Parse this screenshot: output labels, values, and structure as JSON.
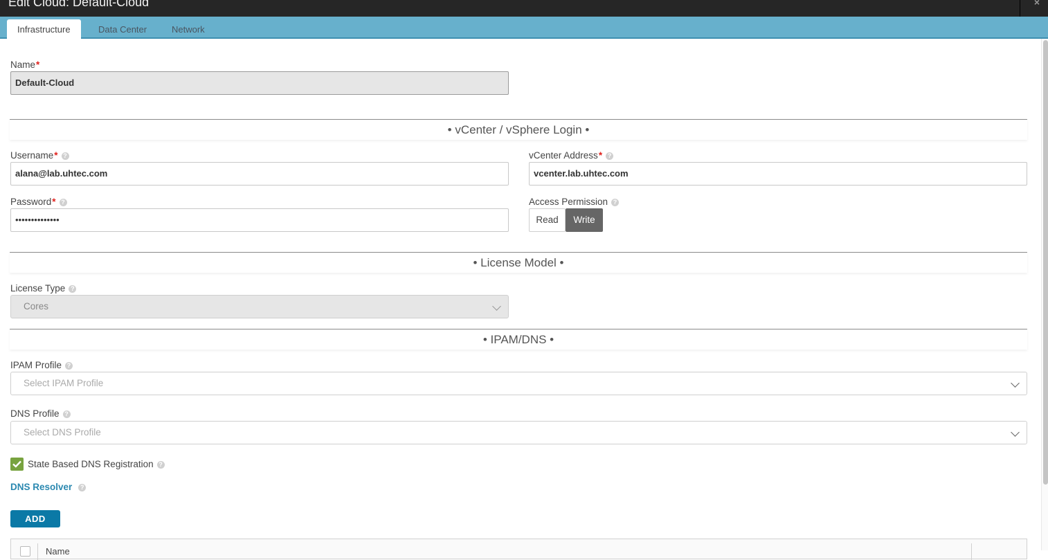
{
  "window": {
    "title": "Edit Cloud: Default-Cloud",
    "close_icon": "×"
  },
  "tabs": [
    {
      "label": "Infrastructure",
      "active": true
    },
    {
      "label": "Data Center",
      "active": false
    },
    {
      "label": "Network",
      "active": false
    }
  ],
  "form": {
    "name": {
      "label": "Name",
      "required_mark": "*",
      "value": "Default-Cloud"
    },
    "sections": {
      "vcenter": "• vCenter / vSphere Login •",
      "license": "• License Model •",
      "ipam_dns": "• IPAM/DNS •"
    },
    "username": {
      "label": "Username",
      "required_mark": "*",
      "value": "alana@lab.uhtec.com"
    },
    "password": {
      "label": "Password",
      "required_mark": "*",
      "value": "••••••••••••••"
    },
    "vcenter_address": {
      "label": "vCenter Address",
      "required_mark": "*",
      "value": "vcenter.lab.uhtec.com"
    },
    "access_permission": {
      "label": "Access Permission",
      "options": [
        "Read",
        "Write"
      ],
      "selected": "Write"
    },
    "license_type": {
      "label": "License Type",
      "value": "Cores"
    },
    "ipam_profile": {
      "label": "IPAM Profile",
      "placeholder": "Select IPAM Profile"
    },
    "dns_profile": {
      "label": "DNS Profile",
      "placeholder": "Select DNS Profile"
    },
    "state_based_dns": {
      "label": "State Based DNS Registration",
      "checked": true
    },
    "dns_resolver": {
      "label": "DNS Resolver"
    },
    "add_button": "ADD",
    "resolver_table": {
      "columns": [
        "Name"
      ]
    }
  },
  "help_icon": "?",
  "colors": {
    "tabbar": "#67b0cc",
    "accent_button": "#0b79a6",
    "checkbox": "#78a33f",
    "required": "#e0201b",
    "link": "#2a88b0"
  }
}
